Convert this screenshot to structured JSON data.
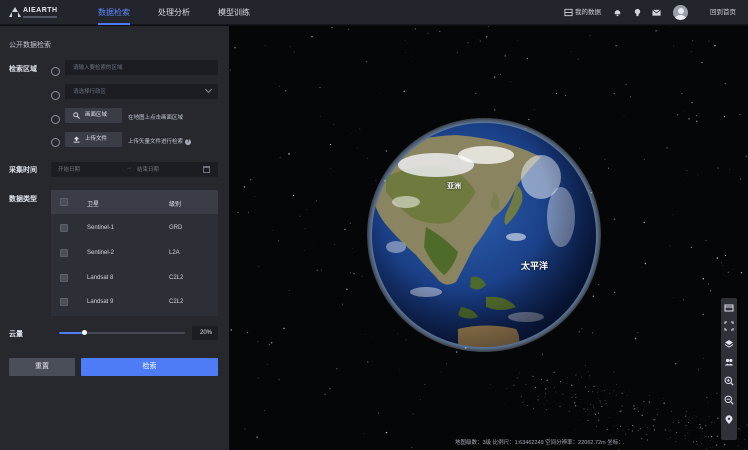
{
  "header": {
    "logo_text": "AIEARTH",
    "tabs": [
      {
        "label": "数据检索",
        "active": true
      },
      {
        "label": "处理分析",
        "active": false
      },
      {
        "label": "模型训练",
        "active": false
      }
    ],
    "my_data": "我的数据",
    "home": "回到首页",
    "icons": [
      "database-icon",
      "bell-icon",
      "bulb-icon",
      "mail-icon",
      "user-avatar"
    ]
  },
  "panel": {
    "title": "公开数据检索",
    "search_area": {
      "label": "检索区域",
      "region_placeholder": "请输入要检索的区域",
      "admin_placeholder": "请选择行政区",
      "draw_button": "画面区域",
      "draw_hint": "在地图上点击画面区域",
      "upload_button": "上传文件",
      "upload_hint": "上传矢量文件进行检索",
      "help": "?"
    },
    "time": {
      "label": "采集时间",
      "start_placeholder": "开始日期",
      "separator": "→",
      "end_placeholder": "结束日期"
    },
    "data_type": {
      "label": "数据类型",
      "columns": [
        "卫星",
        "级别"
      ],
      "rows": [
        {
          "satellite": "Sentinel-1",
          "level": "GRD"
        },
        {
          "satellite": "Sentinel-2",
          "level": "L2A"
        },
        {
          "satellite": "Landsat 8",
          "level": "C2L2"
        },
        {
          "satellite": "Landsat 9",
          "level": "C2L2"
        }
      ]
    },
    "cloud": {
      "label": "云量",
      "value_text": "20%",
      "value": 0.2
    },
    "reset": "重置",
    "search": "检索"
  },
  "map": {
    "labels": {
      "china": "亚洲",
      "pacific": "太平洋"
    },
    "status": "地图级数：3级   比例尺：1:63462249   空间分辨率：22062.72m   坐标："
  },
  "colors": {
    "accent": "#4e7cf6",
    "panel_bg": "#26282e",
    "topbar_bg": "#23252c"
  }
}
